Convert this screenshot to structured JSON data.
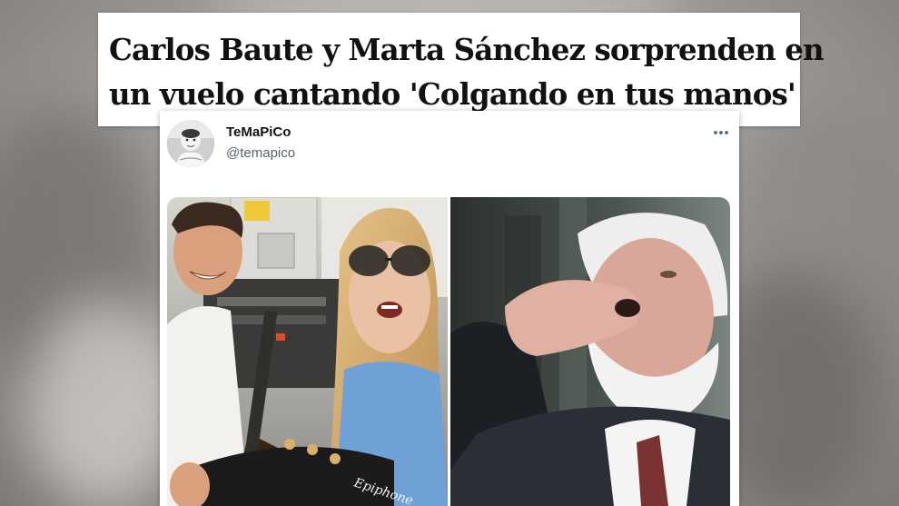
{
  "headline": {
    "line1": "Carlos Baute y Marta Sánchez sorprenden en",
    "line2": "un vuelo cantando 'Colgando en tus manos'"
  },
  "tweet": {
    "display_name": "TeMaPiCo",
    "handle": "@temapico",
    "more_icon": "more-horizontal-icon",
    "avatar": "baby-photo-avatar",
    "media": [
      {
        "name": "singers-on-plane-photo",
        "guitar_brand": "Epiphone"
      },
      {
        "name": "man-drinking-photo"
      }
    ]
  },
  "colors": {
    "name_text": "#0f1419",
    "handle_text": "#536471",
    "headline_text": "#111111"
  }
}
